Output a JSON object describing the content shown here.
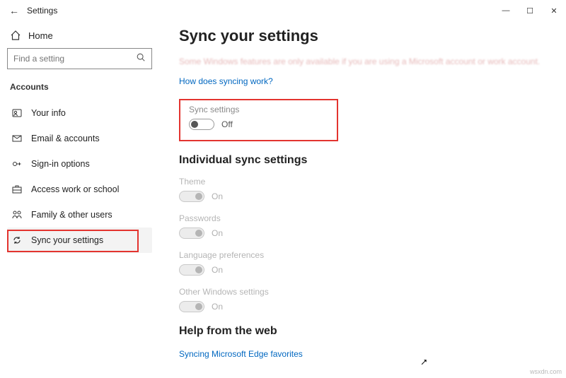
{
  "window": {
    "title": "Settings",
    "min": "—",
    "max": "☐",
    "close": "✕"
  },
  "sidebar": {
    "home": "Home",
    "search_placeholder": "Find a setting",
    "section": "Accounts",
    "items": [
      {
        "label": "Your info",
        "icon": "user"
      },
      {
        "label": "Email & accounts",
        "icon": "mail"
      },
      {
        "label": "Sign-in options",
        "icon": "key"
      },
      {
        "label": "Access work or school",
        "icon": "briefcase"
      },
      {
        "label": "Family & other users",
        "icon": "family"
      },
      {
        "label": "Sync your settings",
        "icon": "sync"
      }
    ]
  },
  "page": {
    "title": "Sync your settings",
    "blurred_notice": "Some Windows features are only available if you are using a Microsoft account or work account.",
    "link": "How does syncing work?",
    "main_toggle": {
      "label": "Sync settings",
      "state": "Off"
    },
    "individual_heading": "Individual sync settings",
    "individual": [
      {
        "label": "Theme",
        "state": "On"
      },
      {
        "label": "Passwords",
        "state": "On"
      },
      {
        "label": "Language preferences",
        "state": "On"
      },
      {
        "label": "Other Windows settings",
        "state": "On"
      }
    ],
    "help_heading": "Help from the web",
    "help_link": "Syncing Microsoft Edge favorites"
  },
  "watermark": "wsxdn.com"
}
